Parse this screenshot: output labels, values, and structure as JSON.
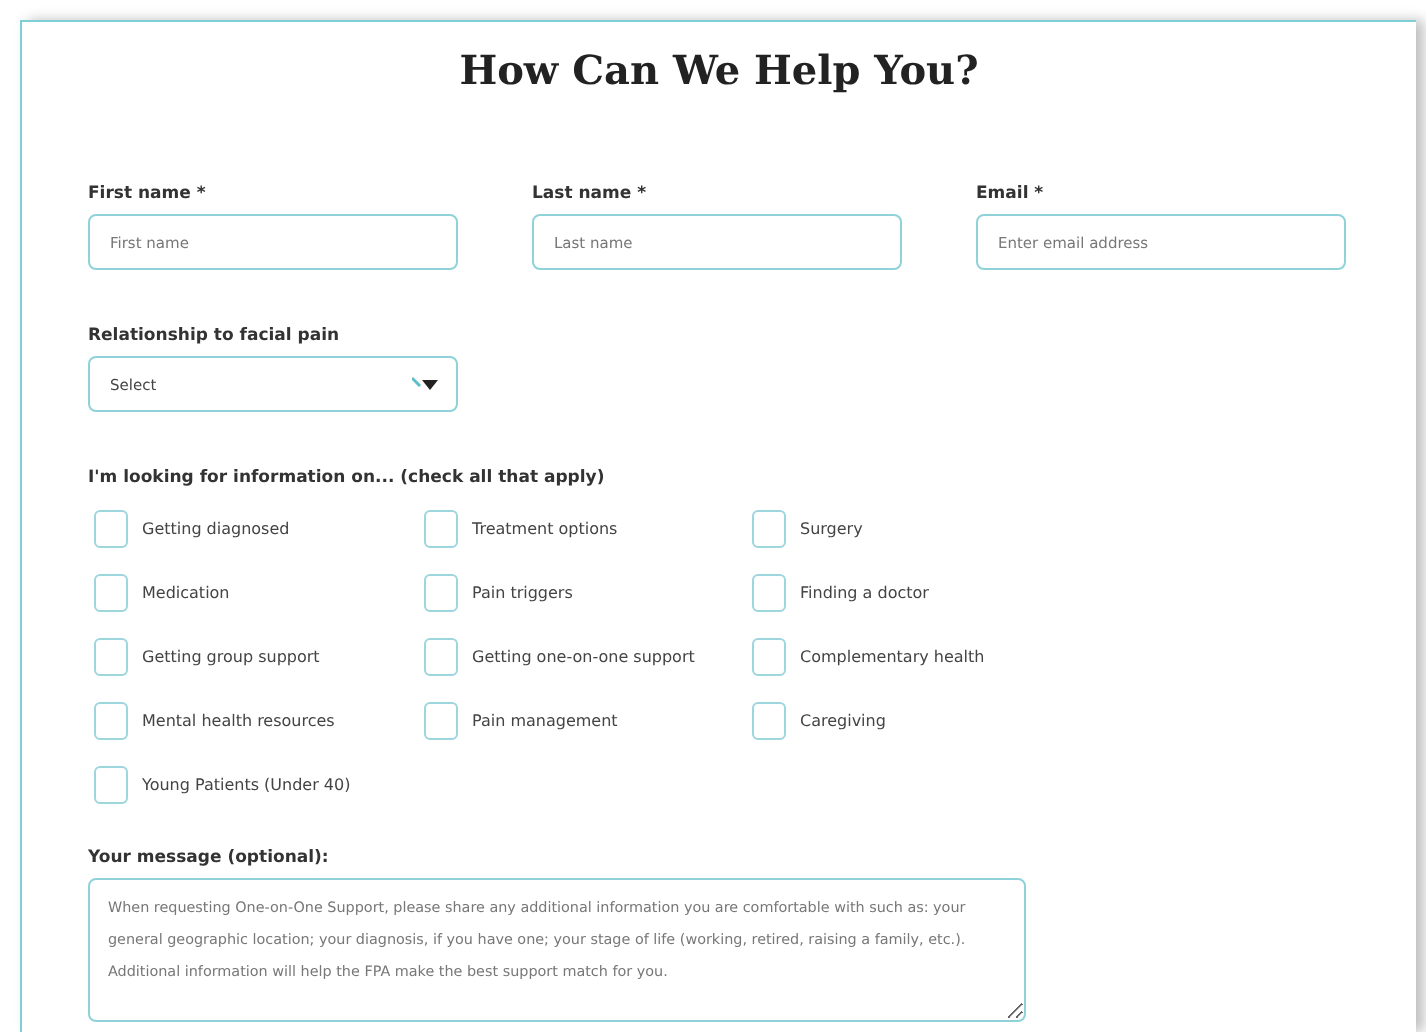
{
  "title": "How Can We Help You?",
  "fields": [
    {
      "label": "First name",
      "required_mark": "*",
      "placeholder": "First name"
    },
    {
      "label": "Last name",
      "required_mark": "*",
      "placeholder": "Last name"
    },
    {
      "label": "Email",
      "required_mark": "*",
      "placeholder": "Enter email address"
    }
  ],
  "relationship": {
    "label": "Relationship to facial pain",
    "value": "Select"
  },
  "interests": {
    "label": "I'm looking for information on... (check all that apply)",
    "options": [
      {
        "label": "Getting diagnosed",
        "checked": false
      },
      {
        "label": "Treatment options",
        "checked": false
      },
      {
        "label": "Surgery",
        "checked": false
      },
      {
        "label": "Medication",
        "checked": false
      },
      {
        "label": "Pain triggers",
        "checked": false
      },
      {
        "label": "Finding a doctor",
        "checked": false
      },
      {
        "label": "Getting group support",
        "checked": false
      },
      {
        "label": "Getting one-on-one support",
        "checked": false
      },
      {
        "label": "Complementary health",
        "checked": false
      },
      {
        "label": "Mental health resources",
        "checked": false
      },
      {
        "label": "Pain management",
        "checked": false
      },
      {
        "label": "Caregiving",
        "checked": false
      },
      {
        "label": "Young Patients (Under 40)",
        "checked": false
      }
    ]
  },
  "message": {
    "label": "Your message (optional):",
    "placeholder": "When requesting One-on-One Support, please share any additional information you are comfortable with such as: your general geographic location; your diagnosis, if you have one; your stage of life (working, retired, raising a family, etc.). Additional information will help the FPA make the best support match for you."
  }
}
